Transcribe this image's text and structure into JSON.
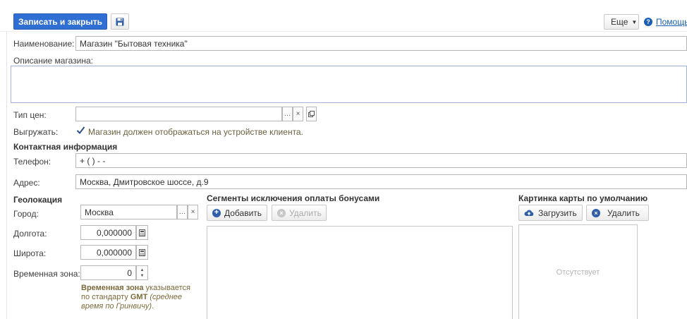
{
  "toolbar": {
    "save_close_label": "Записать и закрыть",
    "more_label": "Еще",
    "help_label": "Помощь"
  },
  "form": {
    "name_label": "Наименование:",
    "name_value": "Магазин \"Бытовая техника\"",
    "description_label": "Описание магазина:",
    "description_value": "",
    "price_type_label": "Тип цен:",
    "price_type_value": "",
    "export_label": "Выгружать:",
    "export_checkbox_label": "Магазин должен отображаться на устройстве клиента.",
    "export_checked": true,
    "contact_heading": "Контактная информация",
    "phone_label": "Телефон:",
    "phone_value": "+ (  )  -  -",
    "address_label": "Адрес:",
    "address_value": "Москва, Дмитровское шоссе, д.9"
  },
  "geolocation": {
    "heading": "Геолокация",
    "city_label": "Город:",
    "city_value": "Москва",
    "longitude_label": "Долгота:",
    "longitude_value": "0,000000",
    "latitude_label": "Широта:",
    "latitude_value": "0,000000",
    "timezone_label": "Временная зона:",
    "timezone_value": "0",
    "hint_bold_1": "Временная зона",
    "hint_text_1": " указывается",
    "hint_text_2": "по стандарту ",
    "hint_bold_2": "GMT",
    "hint_italic": " (среднее время по Гринвичу)",
    "hint_end": "."
  },
  "segments": {
    "heading": "Сегменты исключения оплаты бонусами",
    "add_label": "Добавить",
    "delete_label": "Удалить"
  },
  "map_image": {
    "heading": "Картинка карты по умолчанию",
    "upload_label": "Загрузить",
    "delete_label": "Удалить",
    "placeholder": "Отсутствует"
  },
  "colors": {
    "primary": "#2f6fd3",
    "help_link": "#1a5fb4",
    "hint_text": "#7a6a3a"
  }
}
